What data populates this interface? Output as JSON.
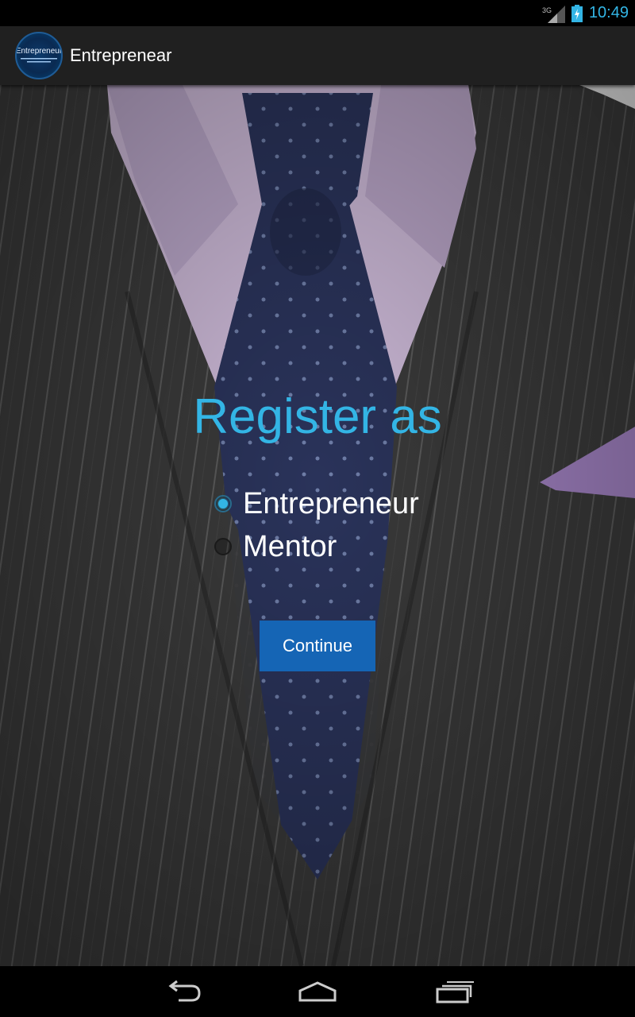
{
  "status_bar": {
    "network": "3G",
    "time": "10:49"
  },
  "action_bar": {
    "logo_text": "Entrepreneur",
    "title": "Entreprenear"
  },
  "main": {
    "heading": "Register as",
    "options": [
      {
        "label": "Entrepreneur",
        "checked": true
      },
      {
        "label": "Mentor",
        "checked": false
      }
    ],
    "continue_label": "Continue"
  },
  "nav_bar": {
    "icons": [
      "back-icon",
      "home-icon",
      "recent-apps-icon"
    ]
  },
  "colors": {
    "accent": "#33b5e5",
    "button": "#1565b5",
    "action_bar": "#202020"
  }
}
